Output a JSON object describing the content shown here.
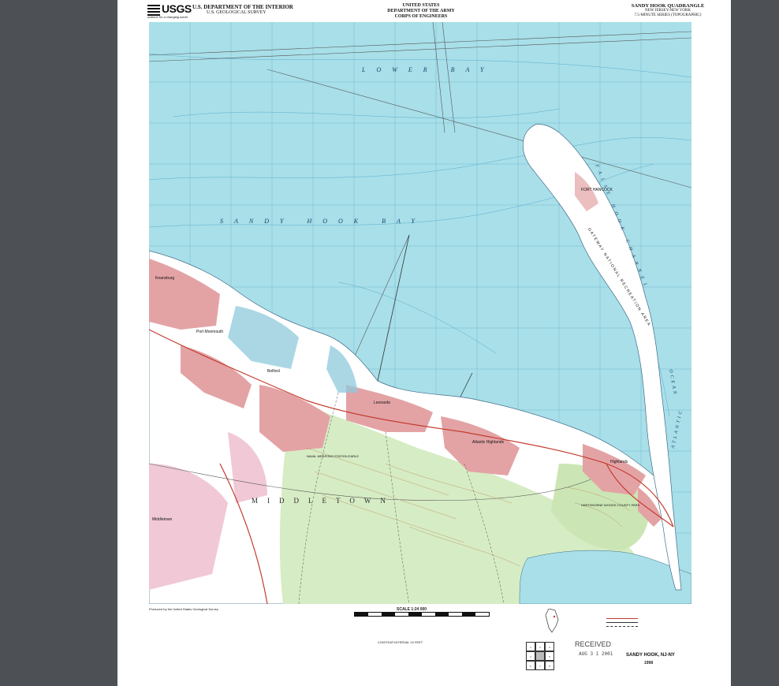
{
  "header": {
    "logo": "USGS",
    "logo_tagline": "science for a changing world",
    "dept_line1": "U.S. DEPARTMENT OF THE INTERIOR",
    "dept_line2": "U.S. GEOLOGICAL SURVEY",
    "center_line1": "UNITED STATES",
    "center_line2": "DEPARTMENT OF THE ARMY",
    "center_line3": "CORPS OF ENGINEERS",
    "quad_title": "SANDY HOOK QUADRANGLE",
    "quad_state": "NEW JERSEY-NEW YORK",
    "quad_series": "7.5-MINUTE SERIES (TOPOGRAPHIC)"
  },
  "map": {
    "water_labels": {
      "lower_bay": "LOWER BAY",
      "sandy_hook_bay": "SANDY HOOK BAY",
      "false_hook_channel": "FALSE HOOK CHANNEL",
      "atlantic": "ATLANTIC",
      "ocean": "OCEAN"
    },
    "places": {
      "port_monmouth": "Port Monmouth",
      "keansburg": "Keansburg",
      "belford": "Belford",
      "leonardo": "Leonardo",
      "atlantic_highlands": "Atlantic Highlands",
      "highlands": "Highlands",
      "middletown": "Middletown",
      "fort_hancock": "FORT HANCOCK",
      "gateway": "GATEWAY NATIONAL RECREATION AREA",
      "navweapstation": "NAVAL WEAPONS STATION EARLE",
      "hartshorne": "HARTSHORNE WOODS COUNTY PARK"
    },
    "township": "MIDDLETOWN"
  },
  "footer": {
    "produced_by": "Produced by the United States Geological Survey",
    "scale": "SCALE 1:24 000",
    "contour": "CONTOUR INTERVAL 10 FEET",
    "received": "RECEIVED",
    "received_date": "AUG 3 1 2001",
    "sheet_name": "SANDY HOOK, NJ-NY",
    "year": "1998"
  },
  "colors": {
    "water": "#a8dfe9",
    "land": "#ffffff",
    "urban": "#e3a3a5",
    "woodland": "#d6ecc4",
    "wetland": "#8fc9dc",
    "road_major": "#c43d2f",
    "contour": "#b88a55"
  }
}
